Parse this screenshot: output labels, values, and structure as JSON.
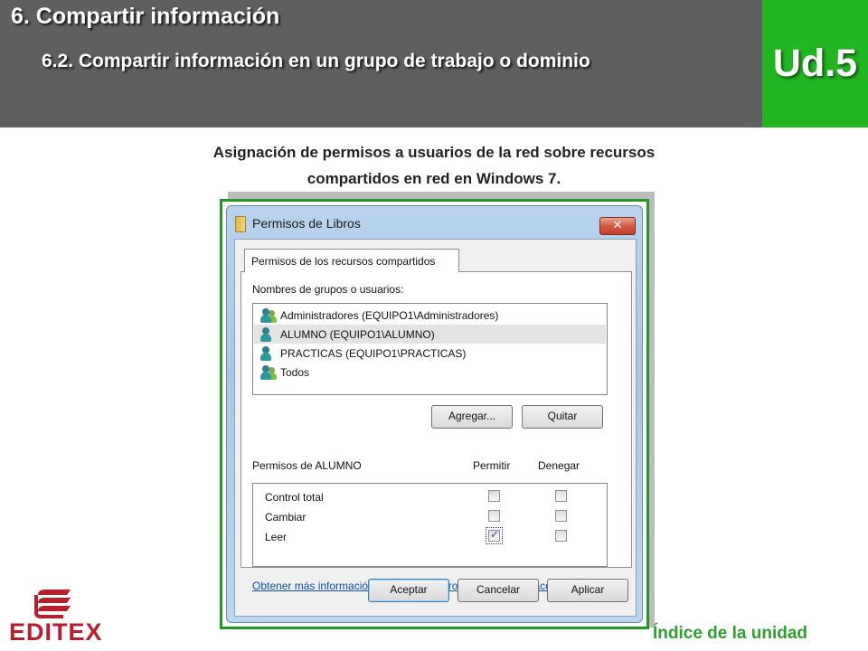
{
  "header": {
    "title": "6. Compartir información",
    "subtitle": "6.2. Compartir información en un grupo de trabajo o dominio",
    "unit": "Ud.5"
  },
  "caption": {
    "line1": "Asignación de permisos a usuarios de la red sobre recursos",
    "line2": "compartidos en red en Windows 7."
  },
  "dialog": {
    "title": "Permisos de Libros",
    "close_label": "✕",
    "tab_label": "Permisos de los recursos compartidos",
    "users_label": "Nombres de grupos o usuarios:",
    "users": [
      {
        "name": "Administradores (EQUIPO1\\Administradores)",
        "icon": "group-icon",
        "selected": false
      },
      {
        "name": "ALUMNO (EQUIPO1\\ALUMNO)",
        "icon": "user-icon",
        "selected": true
      },
      {
        "name": "PRACTICAS (EQUIPO1\\PRACTICAS)",
        "icon": "user-icon",
        "selected": false
      },
      {
        "name": "Todos",
        "icon": "group-icon",
        "selected": false
      }
    ],
    "add_button": "Agregar...",
    "remove_button": "Quitar",
    "permissions_label": "Permisos de ALUMNO",
    "allow_header": "Permitir",
    "deny_header": "Denegar",
    "permissions": [
      {
        "name": "Control total",
        "allow": false,
        "deny": false
      },
      {
        "name": "Cambiar",
        "allow": false,
        "deny": false
      },
      {
        "name": "Leer",
        "allow": true,
        "deny": false
      }
    ],
    "help_link": "Obtener más información acerca de control y permisos de acceso",
    "ok_button": "Aceptar",
    "cancel_button": "Cancelar",
    "apply_button": "Aplicar"
  },
  "footer": {
    "logo_text": "EDITEX",
    "index_link": "Índice de la unidad"
  },
  "colors": {
    "header_bg": "#5f5f5f",
    "unit_bg": "#21b521",
    "frame_border": "#1f9a1f",
    "logo": "#b51f2e",
    "index_link": "#2e9e2e"
  }
}
